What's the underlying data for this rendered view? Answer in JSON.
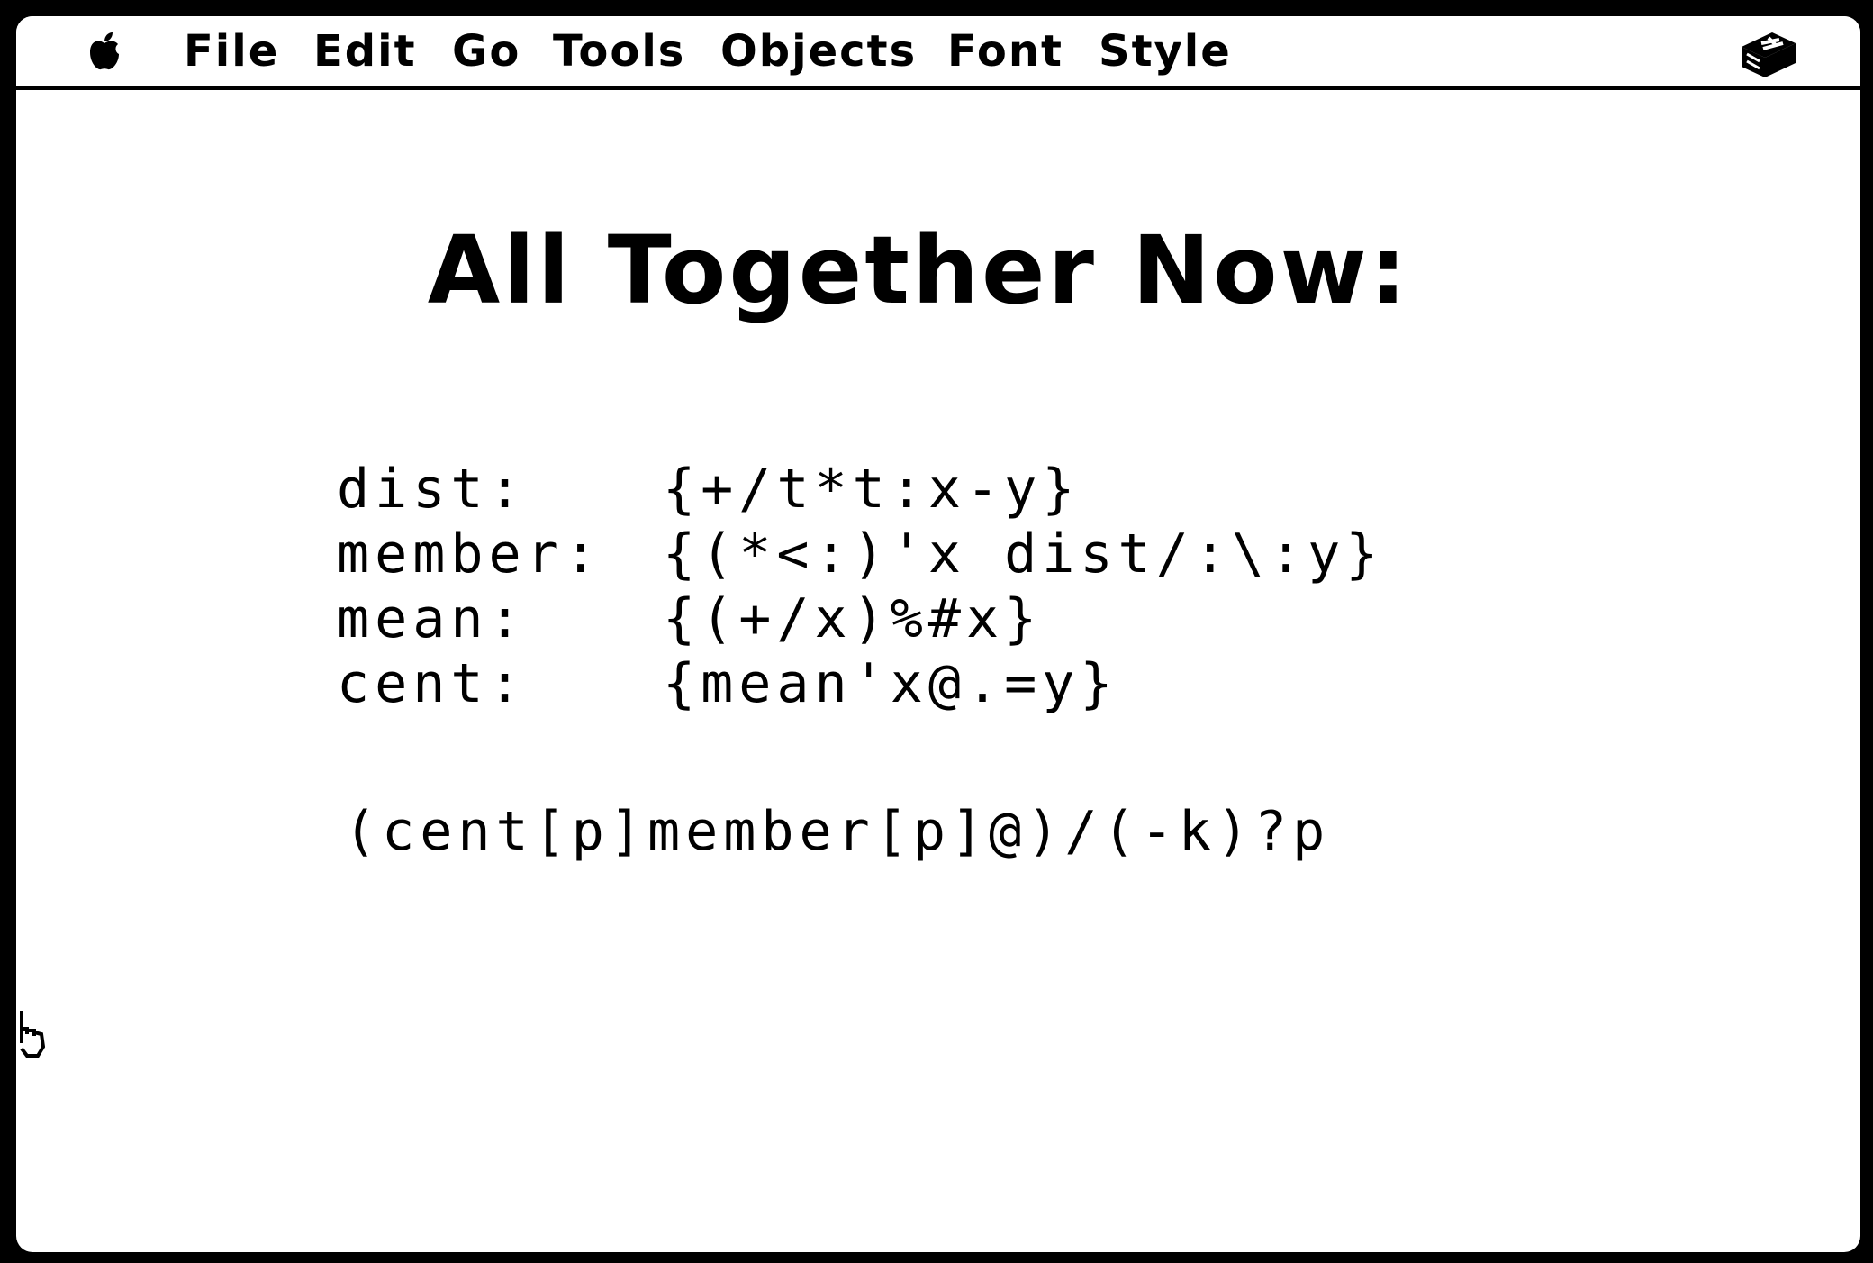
{
  "menubar": {
    "apple_icon": "apple-icon",
    "items": [
      {
        "label": "File"
      },
      {
        "label": "Edit"
      },
      {
        "label": "Go"
      },
      {
        "label": "Tools"
      },
      {
        "label": "Objects"
      },
      {
        "label": "Font"
      },
      {
        "label": "Style"
      }
    ],
    "right_icon": "hypercard-icon"
  },
  "card": {
    "title": "All Together Now:",
    "definitions": [
      {
        "name": "dist:",
        "body": "{+/t*t:x-y}"
      },
      {
        "name": "member:",
        "body": "{(*<:)'x dist/:\\:y}"
      },
      {
        "name": "mean:",
        "body": "{(+/x)%#x}"
      },
      {
        "name": "cent:",
        "body": "{mean'x@.=y}"
      }
    ],
    "expression": "(cent[p]member[p]@)/(-k)?p"
  },
  "cursor": "browse-hand-icon",
  "colors": {
    "background": "#ffffff",
    "foreground": "#000000",
    "bezel": "#000000"
  }
}
